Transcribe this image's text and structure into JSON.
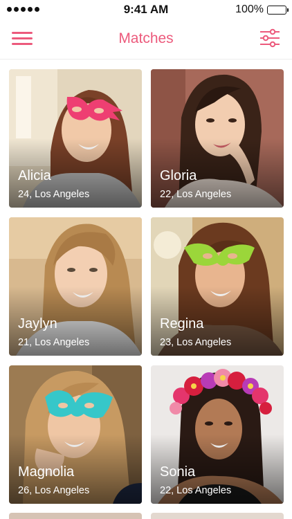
{
  "status_bar": {
    "time": "9:41 AM",
    "battery": "100%",
    "signal_dots": 5
  },
  "header": {
    "title": "Matches",
    "menu_icon": "hamburger-menu-icon",
    "filter_icon": "sliders-filter-icon",
    "accent_color": "#ec5a7c"
  },
  "matches": [
    {
      "name": "Alicia",
      "details": "24, Los Angeles",
      "mask_color": "#ee3f72",
      "hair_color": "#7a4128",
      "bg_color": "#d9c9a8"
    },
    {
      "name": "Gloria",
      "details": "22, Los Angeles",
      "hair_color": "#3a2318",
      "bg_color": "#a7695a"
    },
    {
      "name": "Jaylyn",
      "details": "21, Los Angeles",
      "hair_color": "#b88a52",
      "bg_color": "#d8b98f"
    },
    {
      "name": "Regina",
      "details": "23, Los Angeles",
      "mask_color": "#9bd63a",
      "hair_color": "#6b3a1f",
      "bg_color": "#cfae7c"
    },
    {
      "name": "Magnolia",
      "details": "26, Los Angeles",
      "mask_color": "#36c7c9",
      "hair_color": "#c79a62",
      "bg_color": "#9c7b52"
    },
    {
      "name": "Sonia",
      "details": "22, Los Angeles",
      "flower_crown": true,
      "hair_color": "#2a1a14",
      "bg_color": "#e9e6e4"
    }
  ]
}
